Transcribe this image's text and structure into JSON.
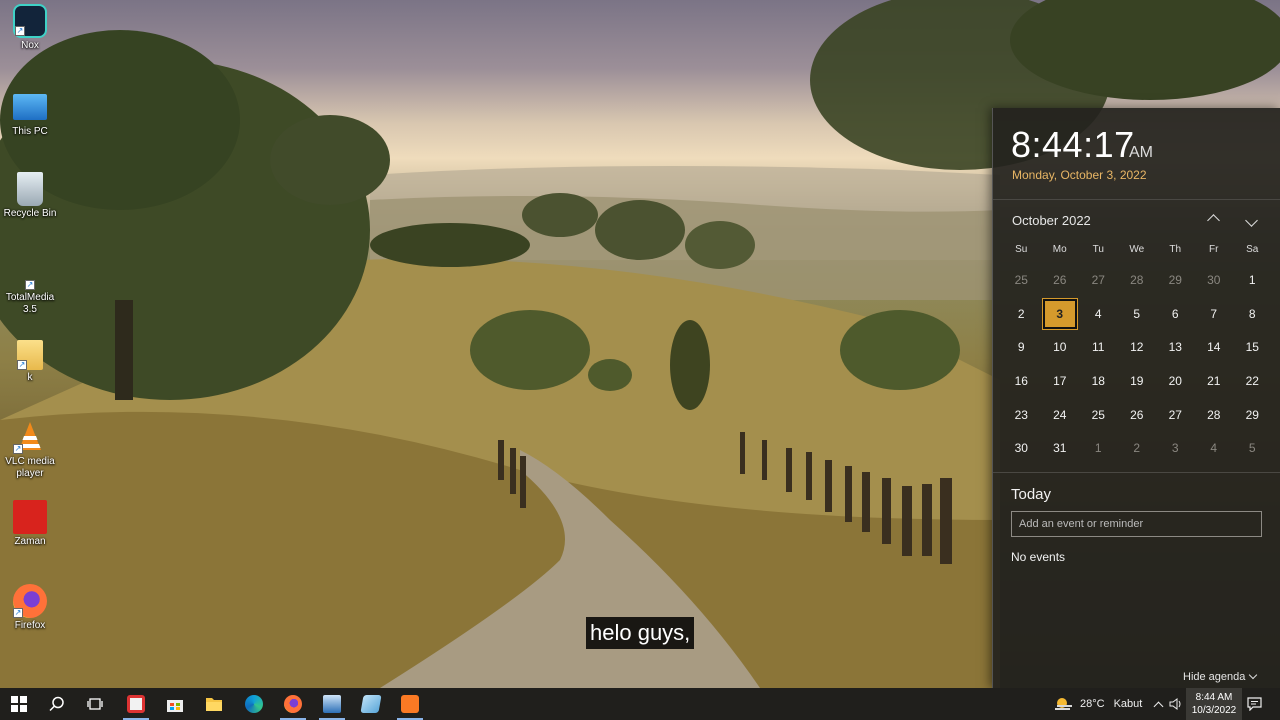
{
  "desktop": {
    "icons": [
      {
        "label": "Nox",
        "icon": "nox-icon"
      },
      {
        "label": "This PC",
        "icon": "computer-icon"
      },
      {
        "label": "Recycle Bin",
        "icon": "recycle-bin-icon"
      },
      {
        "label": "TotalMedia 3.5",
        "icon": "totalmedia-icon"
      },
      {
        "label": "k",
        "icon": "folder-icon"
      },
      {
        "label": "VLC media player",
        "icon": "vlc-icon"
      },
      {
        "label": "Zaman",
        "icon": "zaman-icon"
      },
      {
        "label": "Firefox",
        "icon": "firefox-icon"
      }
    ],
    "subtitle": "helo guys,"
  },
  "flyout": {
    "time": "8:44:17",
    "ampm": "AM",
    "date": "Monday, October 3, 2022",
    "month_label": "October 2022",
    "weekdays": [
      "Su",
      "Mo",
      "Tu",
      "We",
      "Th",
      "Fr",
      "Sa"
    ],
    "days": [
      {
        "n": "25",
        "other": true
      },
      {
        "n": "26",
        "other": true
      },
      {
        "n": "27",
        "other": true
      },
      {
        "n": "28",
        "other": true
      },
      {
        "n": "29",
        "other": true
      },
      {
        "n": "30",
        "other": true
      },
      {
        "n": "1"
      },
      {
        "n": "2"
      },
      {
        "n": "3",
        "today": true
      },
      {
        "n": "4"
      },
      {
        "n": "5"
      },
      {
        "n": "6"
      },
      {
        "n": "7"
      },
      {
        "n": "8"
      },
      {
        "n": "9"
      },
      {
        "n": "10"
      },
      {
        "n": "11"
      },
      {
        "n": "12"
      },
      {
        "n": "13"
      },
      {
        "n": "14"
      },
      {
        "n": "15"
      },
      {
        "n": "16"
      },
      {
        "n": "17"
      },
      {
        "n": "18"
      },
      {
        "n": "19"
      },
      {
        "n": "20"
      },
      {
        "n": "21"
      },
      {
        "n": "22"
      },
      {
        "n": "23"
      },
      {
        "n": "24"
      },
      {
        "n": "25"
      },
      {
        "n": "26"
      },
      {
        "n": "27"
      },
      {
        "n": "28"
      },
      {
        "n": "29"
      },
      {
        "n": "30"
      },
      {
        "n": "31"
      },
      {
        "n": "1",
        "other": true
      },
      {
        "n": "2",
        "other": true
      },
      {
        "n": "3",
        "other": true
      },
      {
        "n": "4",
        "other": true
      },
      {
        "n": "5",
        "other": true
      }
    ],
    "agenda_title": "Today",
    "agenda_placeholder": "Add an event or reminder",
    "no_events": "No events",
    "hide_agenda": "Hide agenda",
    "accent_color": "#d59a2c"
  },
  "taskbar": {
    "apps": [
      "start-icon",
      "search-icon",
      "task-view-icon",
      "media-app-icon",
      "store-icon",
      "file-explorer-icon",
      "edge-icon",
      "firefox-icon",
      "remote-desktop-icon",
      "notepad-icon",
      "xampp-icon"
    ],
    "weather_temp": "28°C",
    "weather_desc": "Kabut",
    "clock_time": "8:44 AM",
    "clock_date": "10/3/2022"
  }
}
